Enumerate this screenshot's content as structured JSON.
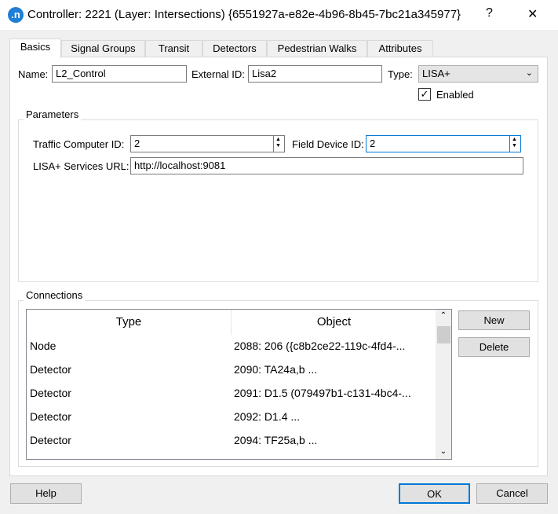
{
  "window": {
    "title": "Controller: 2221 (Layer: Intersections) {6551927a-e82e-4b96-8b45-7bc21a345977}",
    "app_icon": ".n",
    "help_glyph": "?",
    "close_glyph": "✕"
  },
  "tabs": [
    "Basics",
    "Signal Groups",
    "Transit",
    "Detectors",
    "Pedestrian Walks",
    "Attributes"
  ],
  "active_tab": "Basics",
  "basics": {
    "name_label": "Name:",
    "name_value": "L2_Control",
    "extid_label": "External ID:",
    "extid_value": "Lisa2",
    "type_label": "Type:",
    "type_value": "LISA+",
    "enabled_label": "Enabled",
    "enabled": true
  },
  "parameters": {
    "title": "Parameters",
    "tc_label": "Traffic Computer ID:",
    "tc_value": "2",
    "fd_label": "Field Device ID:",
    "fd_value": "2",
    "url_label": "LISA+ Services URL:",
    "url_value": "http://localhost:9081"
  },
  "connections": {
    "title": "Connections",
    "columns": [
      "Type",
      "Object"
    ],
    "rows": [
      [
        "Node",
        "2088: 206 ({c8b2ce22-119c-4fd4-..."
      ],
      [
        "Detector",
        "2090: TA24a,b ..."
      ],
      [
        "Detector",
        "2091: D1.5 (079497b1-c131-4bc4-..."
      ],
      [
        "Detector",
        "2092: D1.4 ..."
      ],
      [
        "Detector",
        "2094: TF25a,b ..."
      ]
    ],
    "new_label": "New",
    "delete_label": "Delete"
  },
  "footer": {
    "help": "Help",
    "ok": "OK",
    "cancel": "Cancel"
  },
  "colors": {
    "accent": "#0078d7",
    "app_icon": "#1e7fd6"
  }
}
